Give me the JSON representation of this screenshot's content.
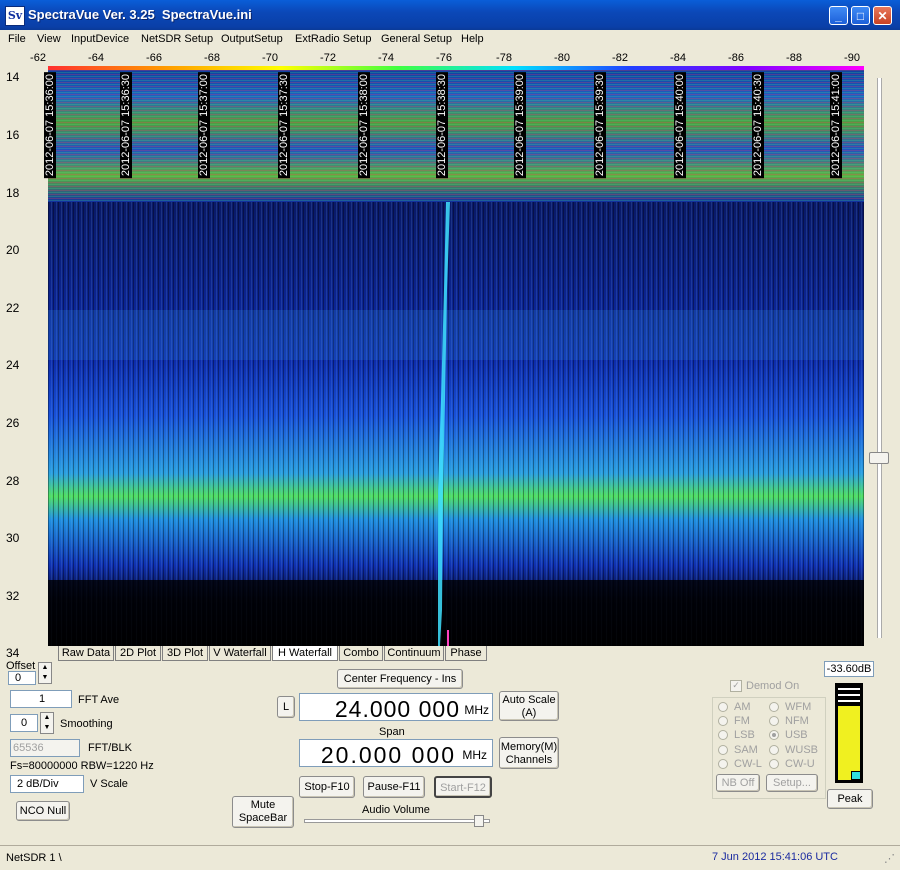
{
  "window": {
    "title": "SpectraVue Ver. 3.25  SpectraVue.ini",
    "icon_text": "Sv",
    "minimize_glyph": "_",
    "maximize_glyph": "□",
    "close_glyph": "✕"
  },
  "menu": [
    "File",
    "View",
    "InputDevice",
    "NetSDR Setup",
    "OutputSetup",
    "ExtRadio Setup",
    "General Setup",
    "Help"
  ],
  "freq_scale": [
    "-62",
    "-64",
    "-66",
    "-68",
    "-70",
    "-72",
    "-74",
    "-76",
    "-78",
    "-80",
    "-82",
    "-84",
    "-86",
    "-88",
    "-90"
  ],
  "y_axis": [
    "14",
    "16",
    "18",
    "20",
    "22",
    "24",
    "26",
    "28",
    "30",
    "32",
    "34"
  ],
  "time_labels": [
    "2012-06-07 15:36:00",
    "2012-06-07 15:36:30",
    "2012-06-07 15:37:00",
    "2012-06-07 15:37:30",
    "2012-06-07 15:38:00",
    "2012-06-07 15:38:30",
    "2012-06-07 15:39:00",
    "2012-06-07 15:39:30",
    "2012-06-07 15:40:00",
    "2012-06-07 15:40:30",
    "2012-06-07 15:41:00"
  ],
  "tabs": [
    "Raw Data",
    "2D Plot",
    "3D Plot",
    "V Waterfall",
    "H Waterfall",
    "Combo",
    "Continuum",
    "Phase"
  ],
  "active_tab": "H Waterfall",
  "controls": {
    "offset_label": "Offset",
    "offset_value": "0",
    "fft_ave_value": "1",
    "fft_ave_label": "FFT Ave",
    "smoothing_value": "0",
    "smoothing_label": "Smoothing",
    "fft_blk_value": "65536",
    "fft_blk_label": "FFT/BLK",
    "fs_info": "Fs=80000000 RBW=1220 Hz",
    "vscale_value": "2 dB/Div",
    "vscale_label": "V Scale",
    "nco_null": "NCO Null",
    "mute_line1": "Mute",
    "mute_line2": "SpaceBar"
  },
  "center": {
    "center_freq_button": "Center Frequency - Ins",
    "l_button": "L",
    "freq_value": "24.000 000",
    "freq_unit": "MHz",
    "span_label": "Span",
    "span_value": "20.000 000",
    "span_unit": "MHz",
    "auto_scale_line1": "Auto Scale",
    "auto_scale_line2": "(A)",
    "memory_line1": "Memory(M)",
    "memory_line2": "Channels",
    "stop_button": "Stop-F10",
    "pause_button": "Pause-F11",
    "start_button": "Start-F12",
    "audio_volume_label": "Audio Volume"
  },
  "demod": {
    "title": "Demod On",
    "modes_left": [
      "AM",
      "FM",
      "LSB",
      "SAM",
      "CW-L"
    ],
    "modes_right": [
      "WFM",
      "NFM",
      "USB",
      "WUSB",
      "CW-U"
    ],
    "selected": "USB",
    "nb_off": "NB Off",
    "setup": "Setup..."
  },
  "meter": {
    "db_value": "-33.60dB",
    "peak_button": "Peak"
  },
  "status": {
    "left": "NetSDR 1  \\",
    "right": "7 Jun 2012  15:41:06 UTC"
  },
  "colors": {
    "titlebar": "#0a48b8",
    "waterfall_bg": "#000010",
    "signal": "#20e0ff"
  }
}
